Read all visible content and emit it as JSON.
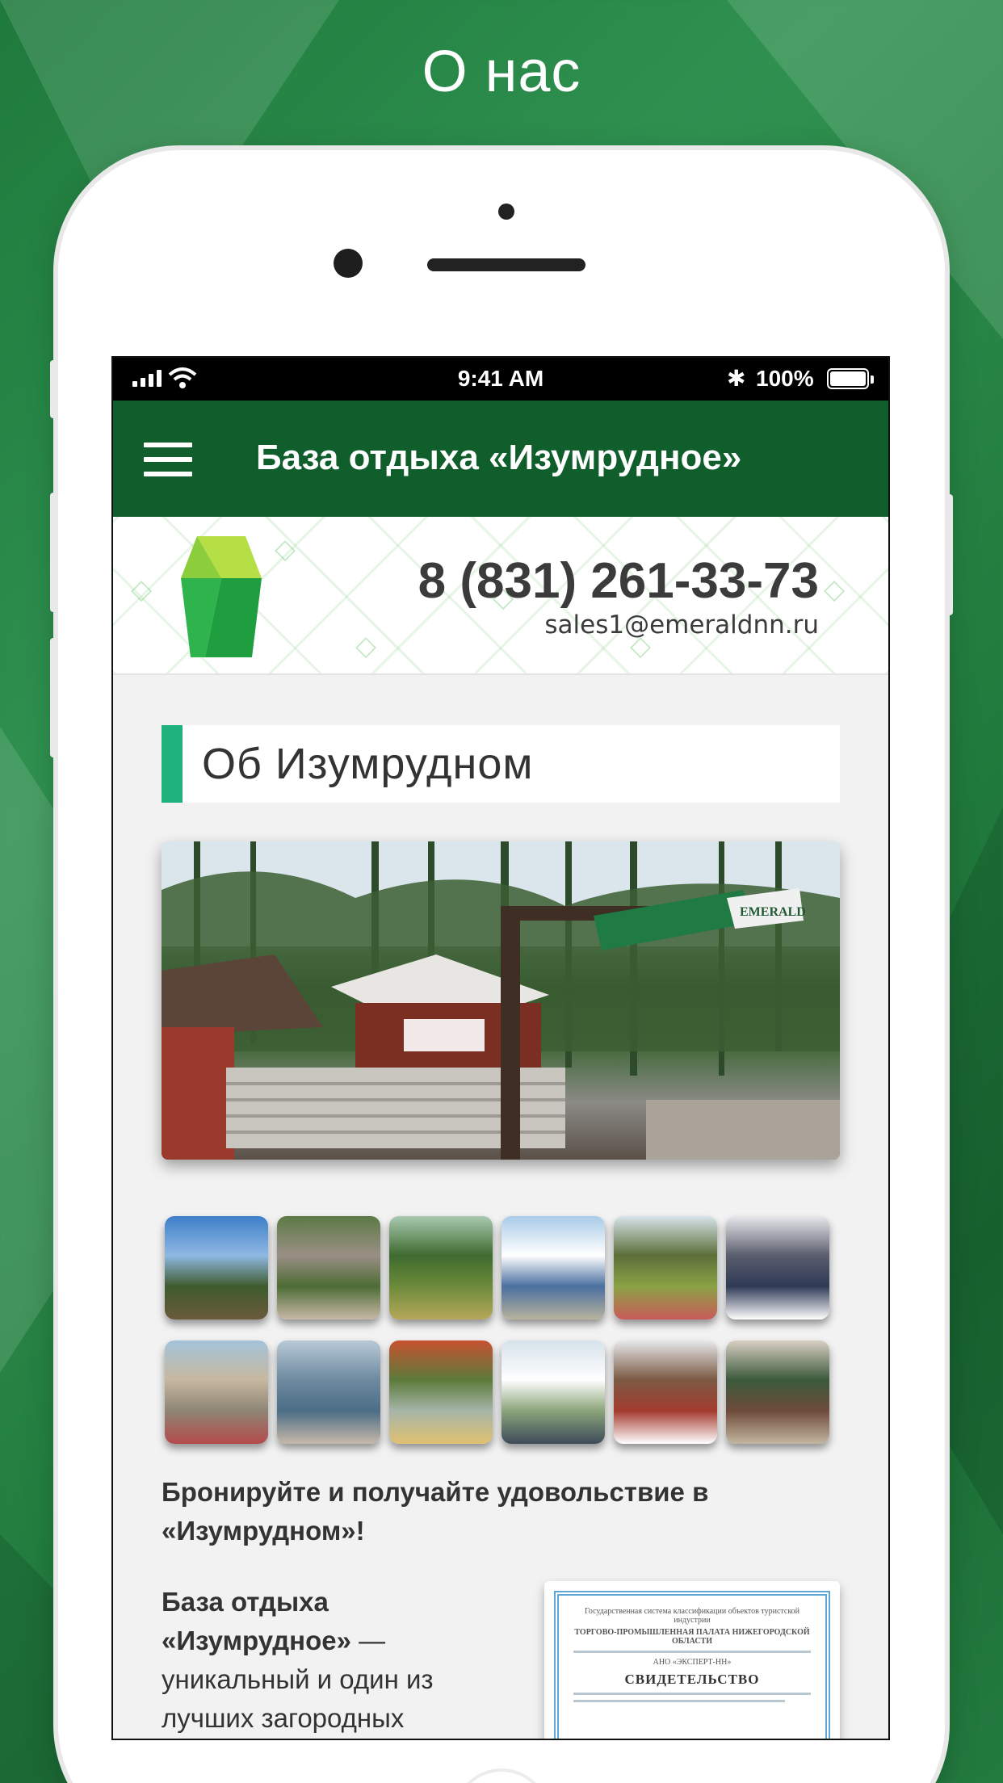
{
  "screen": {
    "title": "О нас"
  },
  "statusbar": {
    "time": "9:41 AM",
    "battery": "100%",
    "bluetooth_icon": "bluetooth-icon"
  },
  "appbar": {
    "title": "База отдыха «Изумрудное»",
    "menu_icon": "hamburger-menu-icon"
  },
  "brand": {
    "phone": "8 (831) 261-33-73",
    "email": "sales1@emeraldnn.ru"
  },
  "section": {
    "heading": "Об Изумрудном"
  },
  "hero": {
    "sign_text": "EMERALD"
  },
  "gallery": {
    "thumbnails": [
      {
        "colors": [
          "#3d7fc9",
          "#8fb8e3",
          "#3e5b2e",
          "#6b5a3c"
        ]
      },
      {
        "colors": [
          "#5c7a45",
          "#9a8f84",
          "#4d6c35",
          "#c9b9a8"
        ]
      },
      {
        "colors": [
          "#a8c9b0",
          "#3f6b2f",
          "#6c8a3a",
          "#b7a85a"
        ]
      },
      {
        "colors": [
          "#a9cbe8",
          "#ffffff",
          "#4a6fa0",
          "#b8b39d"
        ]
      },
      {
        "colors": [
          "#d8e3e9",
          "#5b6e3a",
          "#8aa244",
          "#c95a5a"
        ]
      },
      {
        "colors": [
          "#e8e8ec",
          "#5a5e6d",
          "#2f3a55",
          "#ffffff"
        ]
      },
      {
        "colors": [
          "#a4c3da",
          "#c7b8a0",
          "#8e8575",
          "#b44b4b"
        ]
      },
      {
        "colors": [
          "#b8cad6",
          "#6e8aa0",
          "#4b6d86",
          "#c7b8a8"
        ]
      },
      {
        "colors": [
          "#c7522f",
          "#5c7a3b",
          "#a6b6a9",
          "#e0c070"
        ]
      },
      {
        "colors": [
          "#d6e2ea",
          "#ffffff",
          "#8aa57a",
          "#3e4a5a"
        ]
      },
      {
        "colors": [
          "#e6e8ea",
          "#7c5a44",
          "#a33b2e",
          "#ffffff"
        ]
      },
      {
        "colors": [
          "#d8cfc3",
          "#3b5a3b",
          "#6e4b3a",
          "#c3b6a0"
        ]
      }
    ]
  },
  "promo": {
    "text": "Бронируйте и получайте удовольствие в «Изумрудном»!"
  },
  "description": {
    "bold": "База отдыха «Изумрудное»",
    "rest": " — уникальный и один из лучших загородных"
  },
  "certificate": {
    "header": "Государственная система классификации объектов туристской индустрии",
    "org": "ТОРГОВО-ПРОМЫШЛЕННАЯ ПАЛАТА НИЖЕГОРОДСКОЙ ОБЛАСТИ",
    "issuer": "АНО «ЭКСПЕРТ-НН»",
    "title": "СВИДЕТЕЛЬСТВО"
  }
}
